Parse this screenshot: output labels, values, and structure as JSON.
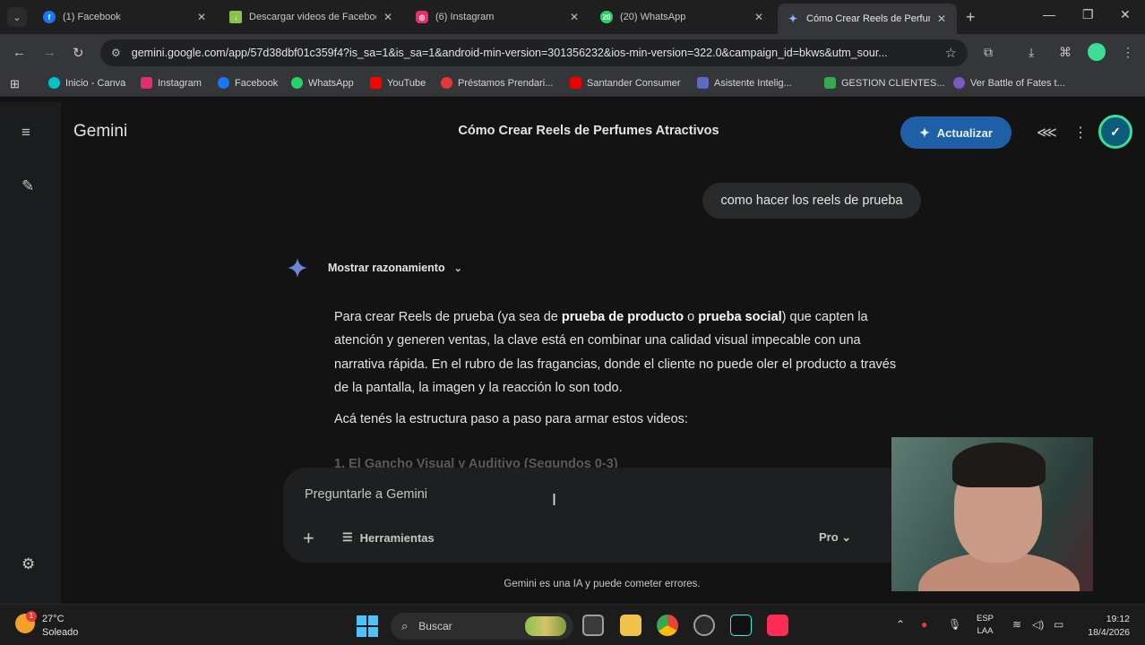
{
  "browser": {
    "tabs": [
      {
        "title": "(1) Facebook",
        "icon": "facebook-icon",
        "color": "#1877f2"
      },
      {
        "title": "Descargar videos de Facebook",
        "icon": "download-icon",
        "color": "#8bc34a"
      },
      {
        "title": "(6) Instagram",
        "icon": "instagram-icon",
        "color": "#e1306c"
      },
      {
        "title": "(20) WhatsApp",
        "icon": "whatsapp-icon",
        "color": "#25d366",
        "badge": "20"
      },
      {
        "title": "Cómo Crear Reels de Perfumes",
        "icon": "gemini-icon",
        "color": "#8ab4f8",
        "active": true
      }
    ],
    "url": "gemini.google.com/app/57d38dbf01c359f4?is_sa=1&is_sa=1&android-min-version=301356232&ios-min-version=322.0&campaign_id=bkws&utm_sour...",
    "bookmarks": [
      {
        "label": "Inicio - Canva",
        "color": "#00c4cc"
      },
      {
        "label": "Instagram",
        "color": "#e1306c"
      },
      {
        "label": "Facebook",
        "color": "#1877f2"
      },
      {
        "label": "WhatsApp",
        "color": "#25d366"
      },
      {
        "label": "YouTube",
        "color": "#ff0000"
      },
      {
        "label": "Préstamos Prendari...",
        "color": "#e53935"
      },
      {
        "label": "Santander Consumer",
        "color": "#ec0000"
      },
      {
        "label": "Asistente Intelig...",
        "color": "#5c6bc0"
      },
      {
        "label": "GESTION CLIENTES...",
        "color": "#34a853"
      },
      {
        "label": "Ver Battle of Fates t...",
        "color": "#7e57c2"
      }
    ]
  },
  "gemini": {
    "brand": "Gemini",
    "conversation_title": "Cómo Crear Reels de Perfumes Atractivos",
    "upgrade_label": "Actualizar",
    "user_message": "como hacer los reels de prueba",
    "reasoning_label": "Mostrar razonamiento",
    "answer": {
      "p1_a": "Para crear Reels de prueba (ya sea de ",
      "p1_b1": "prueba de producto",
      "p1_c": " o ",
      "p1_b2": "prueba social",
      "p1_d": ") que capten la atención y generen ventas, la clave está en combinar una calidad visual impecable con una narrativa rápida. En el rubro de las fragancias, donde el cliente no puede oler el producto a través de la pantalla, la imagen y la reacción lo son todo.",
      "p2": "Acá tenés la estructura paso a paso para armar estos videos:",
      "faded_heading": "1. El Gancho Visual y Auditivo (Segundos 0-3)"
    },
    "composer": {
      "placeholder": "Preguntarle a Gemini",
      "tools_label": "Herramientas",
      "model_label": "Pro"
    },
    "disclaimer": "Gemini es una IA y puede cometer errores."
  },
  "taskbar": {
    "temperature": "27°C",
    "condition": "Soleado",
    "weather_badge": "1",
    "search_label": "Buscar",
    "language_top": "ESP",
    "language_bottom": "LAA",
    "time": "19:12",
    "date": "18/4/2026"
  }
}
